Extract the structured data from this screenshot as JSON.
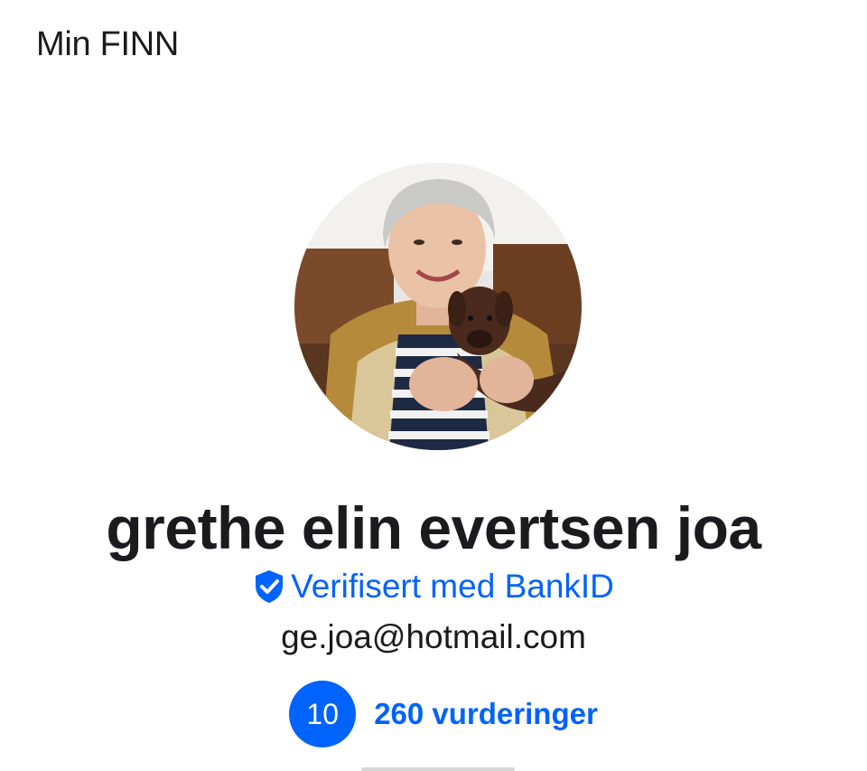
{
  "header": {
    "title": "Min FINN"
  },
  "profile": {
    "avatar_icon": "avatar-photo",
    "name": "grethe elin evertsen joa",
    "verification": {
      "icon": "shield-check-icon",
      "label": "Verifisert med BankID"
    },
    "email": "ge.joa@hotmail.com",
    "rating": {
      "score": "10",
      "reviews_label": "260 vurderinger"
    }
  },
  "colors": {
    "accent": "#0063fb",
    "text": "#1b1b1f",
    "background": "#ffffff"
  }
}
